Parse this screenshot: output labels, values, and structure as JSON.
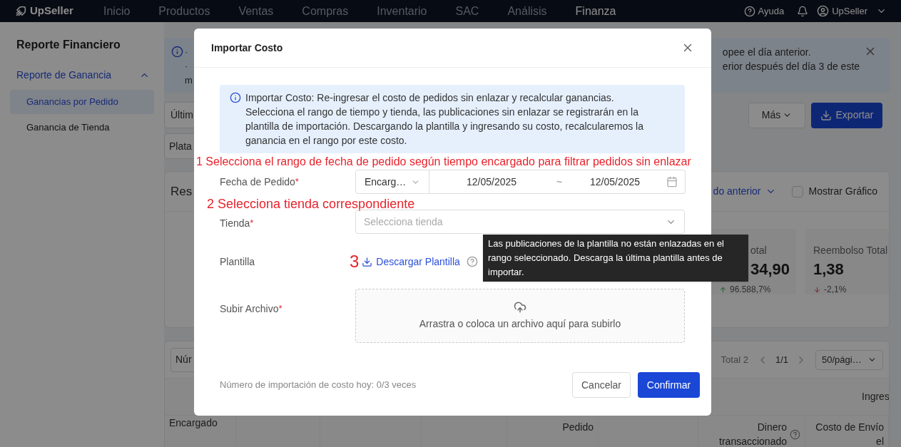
{
  "nav": {
    "logo": "UpSeller",
    "items": [
      {
        "label": "Inicio",
        "selected": false
      },
      {
        "label": "Productos",
        "selected": false
      },
      {
        "label": "Ventas",
        "selected": false
      },
      {
        "label": "Compras",
        "selected": false
      },
      {
        "label": "Inventario",
        "selected": false
      },
      {
        "label": "SAC",
        "selected": false
      },
      {
        "label": "Análisis",
        "selected": false
      },
      {
        "label": "Finanza",
        "selected": true
      }
    ],
    "help": "Ayuda",
    "user": "UpSeller"
  },
  "sidebar": {
    "title": "Reporte Financiero",
    "groups": [
      {
        "label": "Reporte de Ganancia",
        "expanded": true,
        "children": [
          {
            "label": "Ganancias por Pedido",
            "selected": true
          },
          {
            "label": "Ganancia de Tienda",
            "selected": false
          }
        ]
      }
    ]
  },
  "notice": {
    "left_lines": [
      "·",
      "·",
      "m"
    ],
    "right_lines": [
      "opee el día anterior.",
      "erior después del día 3 de este"
    ]
  },
  "toolbar": {
    "filter_1": "Últim",
    "filter_2": "Plata",
    "more": "Más",
    "export": "Exportar"
  },
  "summary": {
    "title": "Res",
    "compare": "do anterior",
    "show_chart": {
      "label": "Mostrar Gráfico",
      "checked": false
    },
    "metrics": [
      {
        "label": "otal",
        "value": "34,90",
        "change": "96.588,7%",
        "increase": true
      },
      {
        "label": "Reembolso Total",
        "value": "1,38",
        "change": "-2,1%",
        "increase": false
      }
    ]
  },
  "table": {
    "search": "Núr",
    "total": "Total 2",
    "page": "1/1",
    "page_size": "50/pági…",
    "group_header": "Ingres",
    "columns": [
      {
        "label": "Encargado",
        "help": false
      },
      {
        "label": "Pedido",
        "help": false
      },
      {
        "label": "Dinero transaccionado",
        "help": true
      },
      {
        "label": "Costo de Envío el",
        "help": false
      }
    ]
  },
  "modal": {
    "title": "Importar Costo",
    "info": [
      "Importar Costo: Re-ingresar el costo de pedidos sin enlazar y recalcular ganancias.",
      "Selecciona el rango de tiempo y tienda, las publicaciones sin enlazar se registrarán en la plantilla de importación. Descargando la plantilla y ingresando su costo, recalcularemos la ganancia en el rango por este costo."
    ],
    "items": [
      {
        "kind": "note",
        "text": "1 Selecciona el rango de fecha de pedido según tiempo encargado para filtrar pedidos sin enlazar"
      },
      {
        "kind": "date_range",
        "label": "Fecha de Pedido",
        "required_mark": "*",
        "type_value": "Encarg…",
        "start": "12/05/2025",
        "separator": "~",
        "end": "12/05/2025"
      },
      {
        "kind": "note",
        "text": "2 Selecciona tienda correspondiente"
      },
      {
        "kind": "select",
        "label": "Tienda",
        "required_mark": "*",
        "placeholder": "Selecciona tienda"
      },
      {
        "kind": "template",
        "label": "Plantilla",
        "step": "3",
        "link": "Descargar Plantilla"
      },
      {
        "kind": "upload",
        "label": "Subir Archivo",
        "required_mark": "*",
        "hint": "Arrastra o coloca un archivo aquí para subirlo"
      }
    ],
    "tooltip": "Las publicaciones de la plantilla no están enlazadas en el rango seleccionado. Descarga la última plantilla antes de importar.",
    "footer_note": "Número de importación de costo hoy: 0/3 veces",
    "cancel": "Cancelar",
    "confirm": "Confirmar"
  }
}
